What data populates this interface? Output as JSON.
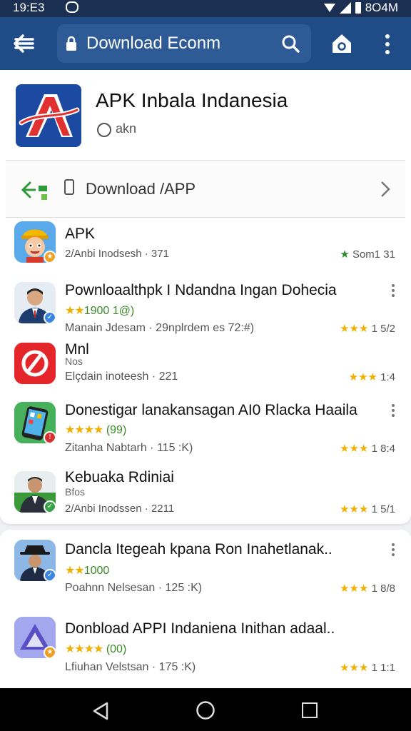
{
  "status": {
    "time": "19:E3",
    "right": "8O4M"
  },
  "browser": {
    "url": "Download Econm"
  },
  "header": {
    "title": "APK Inbala Indanesia",
    "subtitle": "akn"
  },
  "download_row": {
    "label": "Download /APP"
  },
  "apps": [
    {
      "title": "APK",
      "subtitle": "",
      "rating_stars": "",
      "rating_text": "",
      "meta": "2/Anbi Inodsesh · 371",
      "score_stars": "★",
      "score_text": "Som1 31",
      "menu": false
    },
    {
      "title": "Pownloaalthpk I Ndandna Ingan Dohecia",
      "subtitle": "",
      "rating_stars": "★★",
      "rating_text": "1900  1@)",
      "meta": "Manain Jdesam · 29nplrdem es 72:#)",
      "score_stars": "★★★",
      "score_text": "1 5/2",
      "menu": true
    },
    {
      "title": "Mnl",
      "subtitle": "Nos",
      "rating_stars": "",
      "rating_text": "",
      "meta": "Elçdain inoteesh · 221",
      "score_stars": "★★★",
      "score_text": "1:4",
      "menu": false
    },
    {
      "title": "Donestigar lanakansagan AI0 Rlacka Haaila",
      "subtitle": "",
      "rating_stars": "★★★★",
      "rating_text": "(99)",
      "meta": "Zitanha Nabtarh · 115 :K)",
      "score_stars": "★★★",
      "score_text": "1 8:4",
      "menu": true
    },
    {
      "title": "Kebuaka Rdiniai",
      "subtitle": "Bfos",
      "rating_stars": "",
      "rating_text": "",
      "meta": "2/Anbi Inodssen · 2211",
      "score_stars": "★★★",
      "score_text": "1 5/1",
      "menu": false
    },
    {
      "title": "Dancla Itegeah kpana Ron Inahetlanak..",
      "subtitle": "",
      "rating_stars": "★★",
      "rating_text": "1000",
      "meta": "Poahnn Nelsesan · 125 :K)",
      "score_stars": "★★★",
      "score_text": "1 8/8",
      "menu": true
    },
    {
      "title": "Donbload APPI Indaniena Inithan adaal..",
      "subtitle": "",
      "rating_stars": "★★★★",
      "rating_text": "(00)",
      "meta": "Lfiuhan Velstsan · 175 :K)",
      "score_stars": "★★★",
      "score_text": "1 1:1",
      "menu": false
    }
  ]
}
